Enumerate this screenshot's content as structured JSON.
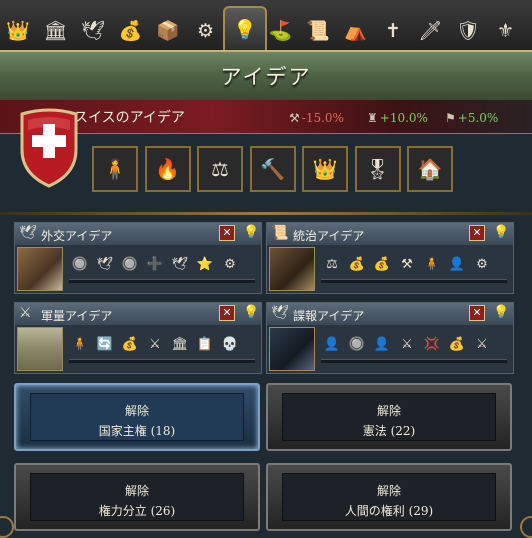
{
  "tabs": [
    {
      "name": "crown-icon",
      "glyph": "👑"
    },
    {
      "name": "government-building-icon",
      "glyph": "🏛"
    },
    {
      "name": "dove-icon",
      "glyph": "🕊"
    },
    {
      "name": "economy-coins-icon",
      "glyph": "💰"
    },
    {
      "name": "trade-chest-icon",
      "glyph": "📦"
    },
    {
      "name": "production-gears-icon",
      "glyph": "⚙"
    },
    {
      "name": "ideas-lightbulb-icon",
      "glyph": "💡",
      "active": true
    },
    {
      "name": "flag-icon",
      "glyph": "⛳"
    },
    {
      "name": "scrolls-icon",
      "glyph": "📜"
    },
    {
      "name": "military-tent-icon",
      "glyph": "⛺"
    },
    {
      "name": "religion-cross-icon",
      "glyph": "✝"
    },
    {
      "name": "espionage-icon",
      "glyph": "🗡"
    },
    {
      "name": "estates-icon",
      "glyph": "🛡"
    },
    {
      "name": "subjects-icon",
      "glyph": "⚜"
    }
  ],
  "title": "アイデア",
  "country": {
    "name": "スイスのアイデア",
    "modifiers": [
      {
        "icon": "⚒",
        "value": "-15.0%",
        "type": "neg"
      },
      {
        "icon": "♜",
        "value": "+10.0%",
        "type": "pos"
      },
      {
        "icon": "⚑",
        "value": "+5.0%",
        "type": "pos"
      }
    ],
    "national_ideas": [
      {
        "name": "infantry-plus-idea-icon",
        "glyph": "🧍"
      },
      {
        "name": "torch-idea-icon",
        "glyph": "🔥"
      },
      {
        "name": "scales-gold-idea-icon",
        "glyph": "⚖"
      },
      {
        "name": "tools-idea-icon",
        "glyph": "🔨"
      },
      {
        "name": "crown-hammer-idea-icon",
        "glyph": "👑"
      },
      {
        "name": "medal-idea-icon",
        "glyph": "🎖"
      },
      {
        "name": "building-upgrade-idea-icon",
        "glyph": "🏠"
      }
    ]
  },
  "groups": [
    {
      "key": "diplomatic",
      "title": "外交アイデア",
      "icon": "🕊",
      "portrait": "diplomat-portrait",
      "minis": [
        "🔘",
        "🕊",
        "🔘",
        "➕",
        "🕊",
        "⭐",
        "⚙"
      ]
    },
    {
      "key": "administrative",
      "title": "統治アイデア",
      "icon": "📜",
      "portrait": "library-portrait",
      "minis": [
        "⚖",
        "💰",
        "💰",
        "⚒",
        "🧍",
        "👤",
        "⚙"
      ]
    },
    {
      "key": "quantity",
      "title": "軍量アイデア",
      "icon": "⚔",
      "portrait": "army-field-portrait",
      "minis": [
        "🧍",
        "🔄",
        "💰",
        "⚔",
        "🏛",
        "📋",
        "💀"
      ]
    },
    {
      "key": "espionage",
      "title": "諜報アイデア",
      "icon": "🕊",
      "portrait": "spy-portrait",
      "minis": [
        "👤",
        "🔘",
        "👤",
        "⚔",
        "💢",
        "💰",
        "⚔"
      ]
    }
  ],
  "unlocks": [
    {
      "label": "解除",
      "name": "国家主権 (18)",
      "selected": true
    },
    {
      "label": "解除",
      "name": "憲法 (22)"
    },
    {
      "label": "解除",
      "name": "権力分立 (26)"
    },
    {
      "label": "解除",
      "name": "人間の権利 (29)"
    }
  ]
}
